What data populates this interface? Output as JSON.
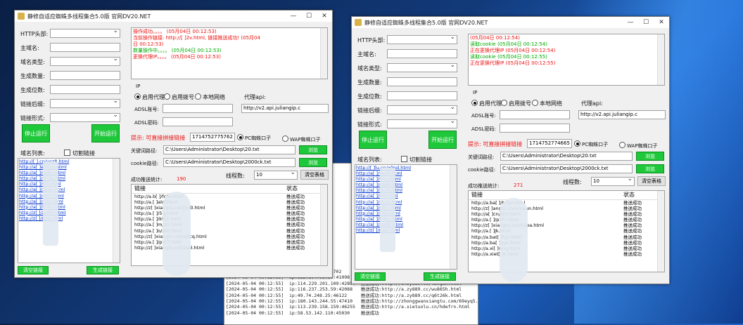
{
  "colors": {
    "accent_green": "#1ec83a",
    "error_red": "#e11111",
    "success_green": "#00aa00",
    "link_blue": "#0033cc"
  },
  "console": {
    "lines": [
      "[2024-05-04 00:12:55]  ip:125.87.66.2:4702       掘送成功:http://ninzh.xiaogu.cn/h/kr.html",
      "[2024-05-04 00:12:55]  ip:112.194.93.39:41098    推送成功:http://zhonggwanxiangtu.com/z345pa.html",
      "[2024-05-04 00:12:55]  ip:114.229.201.109:42894  推送成功:http://a.zy889.cc/lb9g8x.html",
      "[2024-05-04 00:12:55]  ip:116.237.253.59:42088   推送成功:http://a.zy889.cc/wu865h.html",
      "[2024-05-04 00:12:55]  ip:49.74.248.25:46122     推送成功:http://a.zy889.cc/q6t26k.html",
      "[2024-05-04 00:12:55]  ip:180.143.244.55:47410   推送成功:http://zhonggwanxiangtu.com/69eyq5.html",
      "[2024-05-04 00:12:55]  ip:113.239.158.159:46255  推送成功:http://a.xietuolu.cn/hdefrn.html",
      "[2024-05-04 00:12:55]  ip:58.53.142.110:45030    推送成功"
    ],
    "partials": [
      "ited/ge",
      "30757",
      "36757",
      "45271",
      "36687",
      "3.7291",
      "42008",
      "36727",
      "42008",
      "35548",
      "38548"
    ]
  },
  "w1": {
    "title": "静修自适应蜘蛛多线程集合5.0版 官网DV20.NET",
    "form": {
      "http_header": "HTTP头部:",
      "main_domain": "主域名:",
      "link_type": "域名类型:",
      "gen_count": "生成数量:",
      "gen_digits": "生成位数:",
      "link_suffix": "链接后缀:",
      "link_format": "链接形式:"
    },
    "start_btn": "停止运行",
    "start2_btn": "开始运行",
    "log": [
      {
        "t": "操作成功。。。。 (05月04日 00:12:53)",
        "c": "red"
      },
      {
        "t": "当前操作链接: http://[ ]2v.html, 链接推送成功!  (05月04",
        "c": "red"
      },
      {
        "t": "日 00:12:53)",
        "c": "red"
      },
      {
        "t": "数量操作中。。。。 (05月04日 00:12:53)",
        "c": "green"
      },
      {
        "t": "更换代理IP。。。。 (05月04日 00:12:53)",
        "c": "red"
      }
    ],
    "ip_label": "IP",
    "radio": [
      "启用代理",
      "启用拨号",
      "本地网络"
    ],
    "proxy_api_label": "代理api:",
    "proxy_api_value": "http://v2.api.juliangip.c",
    "adsl_account": "ADSL账号:",
    "adsl_pwd": "ADSL密码:",
    "tip": "提示: 可直接拼接链接",
    "tip_value": "1714752775762",
    "pc_spider": "PC蜘蛛口子",
    "wap_spider": "WAP蜘蛛口子",
    "kw_path_label": "关键词路径:",
    "kw_path": "C:\\Users\\Administrator\\Desktop\\20.txt",
    "cookie_label": "cookie路径:",
    "cookie_path": "C:\\Users\\Administrator\\Desktop\\2000ck.txt",
    "browse": "浏览",
    "success_label": "成功推送统计:",
    "success_count": "190",
    "threads_label": "线程数:",
    "threads": "10",
    "clear_table": "清空表格",
    "list_label": "域名列表:",
    "auto_link": "切割链接",
    "list_items": [
      "http://[ ].cn/vez8.html",
      "http://a[ ]e/0lvo.html",
      "http://a[ ]/cq8n.html",
      "http://a[ ]/zh7q.html",
      "http://a[ ]/6lil.html",
      "http://a[ ]/zkun.html",
      "http://a[ ]/c8l7.html",
      "http://a[ ]/r36i.html",
      "http://a[ ]/b7ko.html",
      "http://z[ ]/zw85.html",
      "http://z[ ]/rizw.html"
    ],
    "col_link": "链接",
    "col_status": "状态",
    "rows": [
      {
        "l": "http://a.b[ ]/fc0v.html",
        "s": "推送成功"
      },
      {
        "l": "http://a.[ ]alof.html",
        "s": "推送成功"
      },
      {
        "l": "http://z[ ]xiangtu.net/jvv0.html",
        "s": "推送成功"
      },
      {
        "l": "http://a.[ ]/5ljj.html",
        "s": "推送成功"
      },
      {
        "l": "http://a.[ ]/k9j7.html",
        "s": "推送成功"
      },
      {
        "l": "http://a.[ ]m/ztil.html",
        "s": "推送成功"
      },
      {
        "l": "http://a.[ ]o/zbll.html",
        "s": "推送成功"
      },
      {
        "l": "http://z[ ]xiangtu.net/q9cq.html",
        "s": "推送成功"
      },
      {
        "l": "http://a.[ ]/pbf7.html",
        "s": "推送成功"
      },
      {
        "l": "http://z[ ]xiangtu.net/zsel.html",
        "s": "推送成功"
      }
    ],
    "clear_link": "清空链接",
    "gen_link": "生成链接"
  },
  "w2": {
    "title": "静修自适应蜘蛛多线程集合5.0版 官网DV20.NET",
    "form": {
      "http_header": "HTTP头部:",
      "main_domain": "主域名:",
      "link_type": "域名类型:",
      "gen_count": "生成数量:",
      "gen_digits": "生成位数:",
      "link_suffix": "链接后缀:",
      "link_format": "链接形式:"
    },
    "start_btn": "停止运行",
    "start2_btn": "开始运行",
    "log": [
      {
        "t": "(05月04日 00:12:54)",
        "c": "red"
      },
      {
        "t": "读取cookie (05月04日 00:12:54)",
        "c": "green"
      },
      {
        "t": "正在更换代理IP (05月04日 00:12:54)",
        "c": "red"
      },
      {
        "t": "读取cookie (05月04日 00:12:55)",
        "c": "green"
      },
      {
        "t": "正在更换代理IP (05月04日 00:12:55)",
        "c": "red"
      }
    ],
    "ip_label": "IP",
    "radio": [
      "启用代理",
      "启用拨号",
      "本地网络"
    ],
    "proxy_api_label": "代理api:",
    "proxy_api_value": "http://v2.api.juliangip.c",
    "adsl_account": "ADSL账号:",
    "adsl_pwd": "ADSL密码:",
    "tip": "提示: 可直接拼接链接",
    "tip_value": "1714752774665",
    "pc_spider": "PC蜘蛛口子",
    "wap_spider": "WAP蜘蛛口子",
    "kw_path_label": "关键词路径:",
    "kw_path": "C:\\Users\\Administrator\\Desktop\\20.txt",
    "cookie_label": "cookie路径:",
    "cookie_path": "C:\\Users\\Administrator\\Desktop\\2000ck.txt",
    "browse": "浏览",
    "success_label": "成功推送统计:",
    "success_count": "271",
    "threads_label": "线程数:",
    "threads": "10",
    "clear_table": "清空表格",
    "list_label": "域名列表:",
    "auto_link": "切割链接",
    "list_items": [
      "http://[ ]lu.cn/x0nd.html",
      "http://a[ ]/vez8.html",
      "http://a[ ]/0lvo.html",
      "http://a[ ]/cq8n.html",
      "http://a[ ]/zh7q.html",
      "http://a[ ]/6lil.html",
      "http://a[ ]/zkun.html",
      "http://a[ ]/c8l7.html",
      "http://a[ ]/r36i.html",
      "http://a[ ]/b7ko.html",
      "http://a[ ]/zw85.html",
      "http://z[ ]/rizw.html"
    ],
    "col_link": "链接",
    "col_status": "状态",
    "rows": [
      {
        "l": "http://a.ba[ ]/h7go.html",
        "s": "推送成功"
      },
      {
        "l": "http://z[ ]angtu.com/1wun.html",
        "s": "推送成功"
      },
      {
        "l": "http://a[ ]cn/j60r.html",
        "s": "推送成功"
      },
      {
        "l": "http://a.[ ]/pbf7.html",
        "s": "推送成功"
      },
      {
        "l": "http://z[ ]xiangtu.net/h2ea.html",
        "s": "推送成功"
      },
      {
        "l": "http://a.[ ]jk.html",
        "s": "推送成功"
      },
      {
        "l": "http://a.bat[ ]fgn.html",
        "s": "推送成功"
      },
      {
        "l": "http://a.ba[ ]ygn.html",
        "s": "推送成功"
      },
      {
        "l": "http://a.xi[ ]wug.html",
        "s": "推送成功"
      },
      {
        "l": "http://a.xiet[ ]6.html",
        "s": "推送成功"
      }
    ],
    "clear_link": "清空链接",
    "gen_link": "生成链接"
  }
}
